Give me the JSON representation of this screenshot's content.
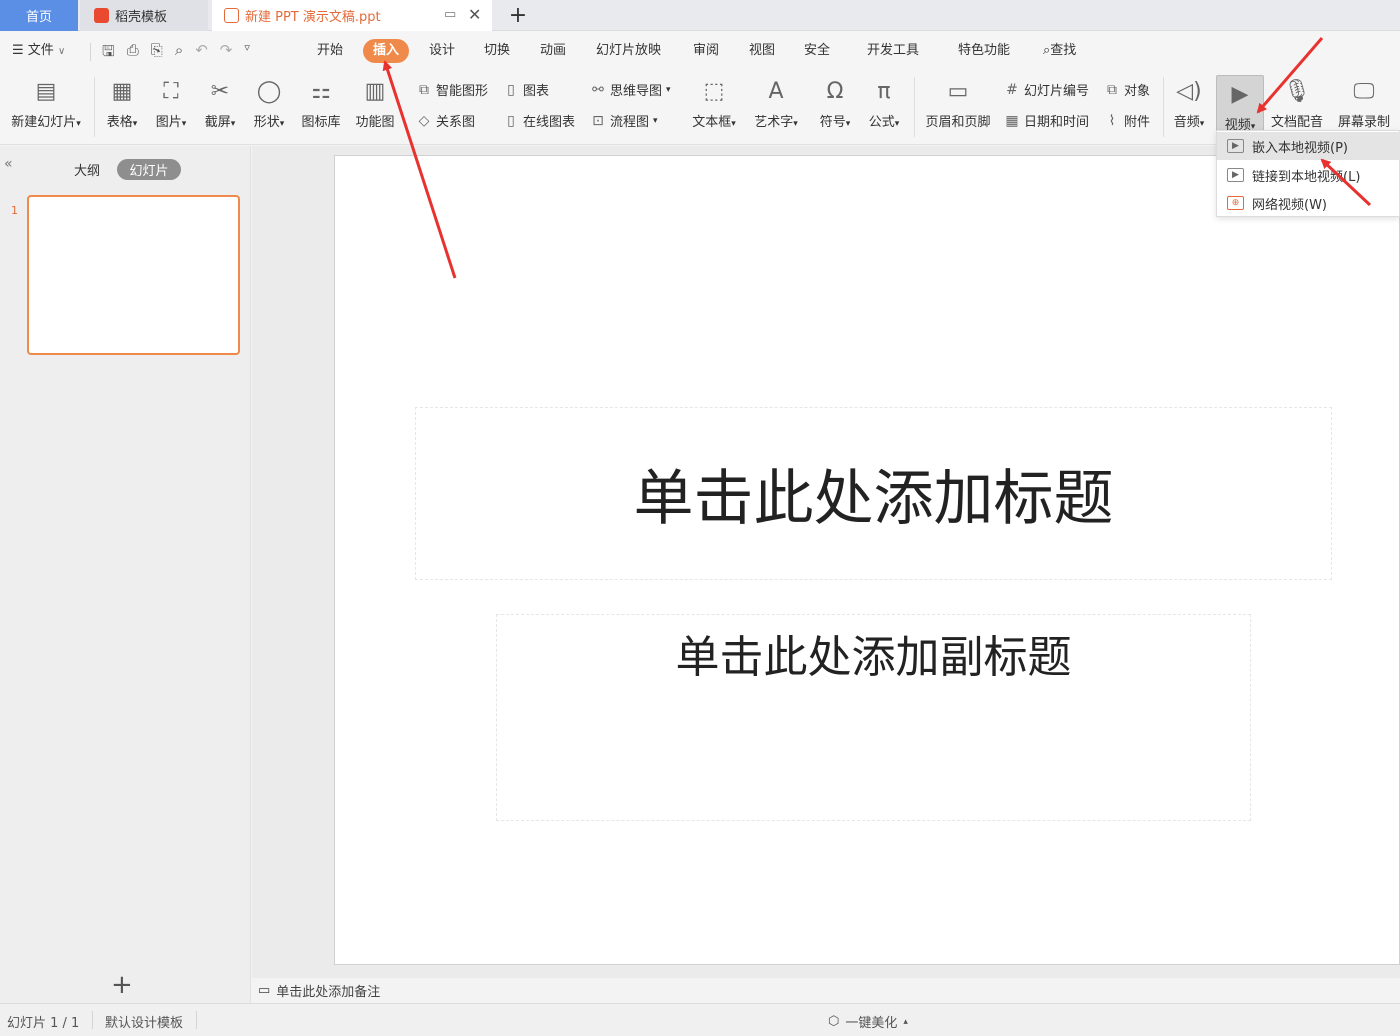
{
  "tabs": {
    "home": "首页",
    "template": "稻壳模板",
    "document": "新建 PPT 演示文稿.ppt",
    "new_tab": "+"
  },
  "menu": {
    "file": "文件",
    "items": [
      "开始",
      "插入",
      "设计",
      "切换",
      "动画",
      "幻灯片放映",
      "审阅",
      "视图",
      "安全",
      "开发工具",
      "特色功能"
    ],
    "find": "查找"
  },
  "ribbon": {
    "new_slide": "新建幻灯片",
    "table": "表格",
    "picture": "图片",
    "screenshot": "截屏",
    "shape": "形状",
    "icon_library": "图标库",
    "function_chart": "功能图",
    "smart_art": "智能图形",
    "chart": "图表",
    "relation": "关系图",
    "online_chart": "在线图表",
    "mind_map": "思维导图",
    "flowchart": "流程图",
    "textbox": "文本框",
    "word_art": "艺术字",
    "symbol": "符号",
    "formula": "公式",
    "header_footer": "页眉和页脚",
    "slide_number": "幻灯片编号",
    "object": "对象",
    "date_time": "日期和时间",
    "attachment": "附件",
    "audio": "音频",
    "video": "视频",
    "doc_dubbing": "文档配音",
    "screen_record": "屏幕录制"
  },
  "video_menu": {
    "embed_local": "嵌入本地视频(P)",
    "link_local": "链接到本地视频(L)",
    "web_video": "网络视频(W)"
  },
  "left_panel": {
    "outline": "大纲",
    "slides": "幻灯片",
    "slide_number": "1",
    "collapse": "«",
    "add": "+"
  },
  "slide": {
    "title_placeholder": "单击此处添加标题",
    "subtitle_placeholder": "单击此处添加副标题"
  },
  "notes_placeholder": "单击此处添加备注",
  "status": {
    "slide_index": "幻灯片 1 / 1",
    "template": "默认设计模板",
    "beautify": "一键美化"
  },
  "colors": {
    "accent": "#f08a4b",
    "home_tab": "#5b8fe6",
    "annotation_arrow": "#e8322f"
  }
}
